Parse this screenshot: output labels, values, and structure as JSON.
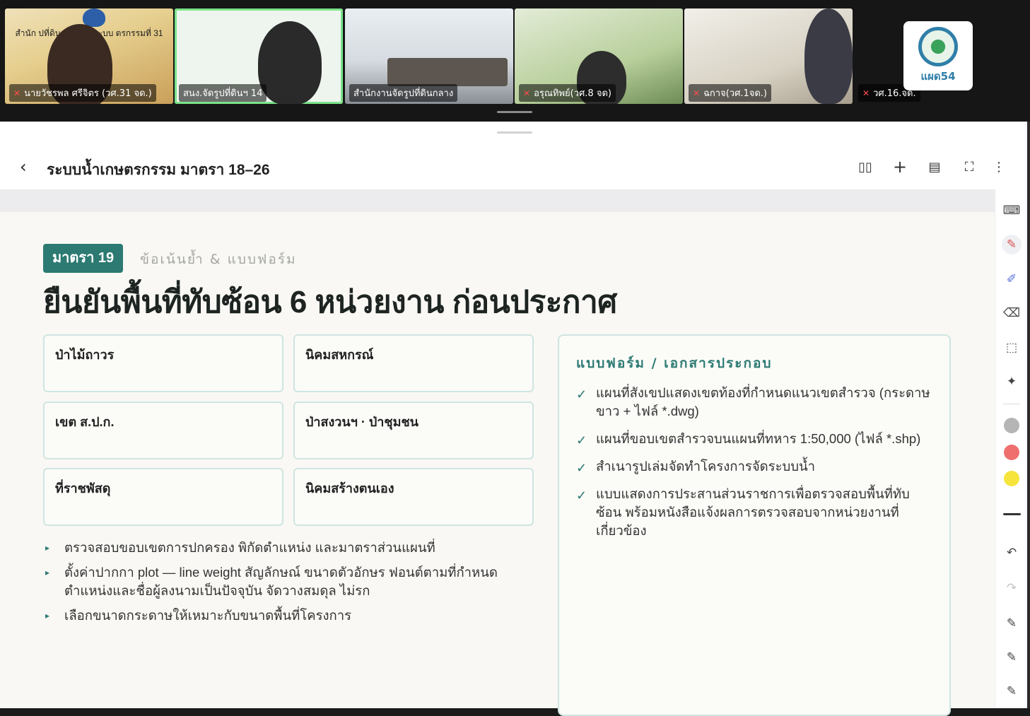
{
  "participants": [
    {
      "name": "นายวัชรพล ศรีจิตร (วศ.31 จด.)",
      "muted": true,
      "sign": "สำนัก  ปที่ดิน / และจัดระบบ  ตรกรรมที่ 31"
    },
    {
      "name": "สนง.จัดรูปที่ดินฯ 14",
      "muted": false,
      "active": true
    },
    {
      "name": "สำนักงานจัดรูปที่ดินกลาง",
      "muted": false
    },
    {
      "name": "อรุณทิพย์(วศ.8 จด)",
      "muted": true
    },
    {
      "name": "ฉกาจ(วศ.1จด.)",
      "muted": true
    },
    {
      "name": "วศ.16.จด.",
      "muted": true,
      "logo_text": "แผด54"
    }
  ],
  "document": {
    "title": "ระบบน้ำเกษตรกรรม มาตรา 18–26",
    "toolbar": [
      "book-icon",
      "plus-icon",
      "edit-doc-icon",
      "fullscreen-icon",
      "more-icon"
    ]
  },
  "slide": {
    "badge": "มาตรา 19",
    "subtitle": "ข้อเน้นย้ำ & แบบฟอร์ม",
    "heading": "ยืนยันพื้นที่ทับซ้อน 6 หน่วยงาน ก่อนประกาศ",
    "agencies": [
      "ป่าไม้ถาวร",
      "นิคมสหกรณ์",
      "เขต ส.ป.ก.",
      "ป่าสงวนฯ · ป่าชุมชน",
      "ที่ราชพัสดุ",
      "นิคมสร้างตนเอง"
    ],
    "bullets": [
      "ตรวจสอบขอบเขตการปกครอง พิกัดตำแหน่ง และมาตราส่วนแผนที่",
      "ตั้งค่าปากกา plot — line weight สัญลักษณ์ ขนาดตัวอักษร ฟอนต์ตามที่กำหนด ตำแหน่งและชื่อผู้ลงนามเป็นปัจจุบัน จัดวางสมดุล ไม่รก",
      "เลือกขนาดกระดาษให้เหมาะกับขนาดพื้นที่โครงการ"
    ],
    "forms_title": "แบบฟอร์ม / เอกสารประกอบ",
    "forms": [
      "แผนที่สังเขปแสดงเขตท้องที่กำหนดแนวเขตสำรวจ (กระดาษขาว + ไฟล์ *.dwg)",
      "แผนที่ขอบเขตสำรวจบนแผนที่ทหาร 1:50,000 (ไฟล์ *.shp)",
      "สำเนารูปเล่มจัดทำโครงการจัดระบบน้ำ",
      "แบบแสดงการประสานส่วนราชการเพื่อตรวจสอบพื้นที่ทับซ้อน พร้อมหนังสือแจ้งผลการตรวจสอบจากหน่วยงานที่เกี่ยวข้อง"
    ]
  },
  "pen_colors": [
    "#b5b5b5",
    "#ef6f6f",
    "#f6e43c"
  ],
  "accent": "#2c7a72"
}
